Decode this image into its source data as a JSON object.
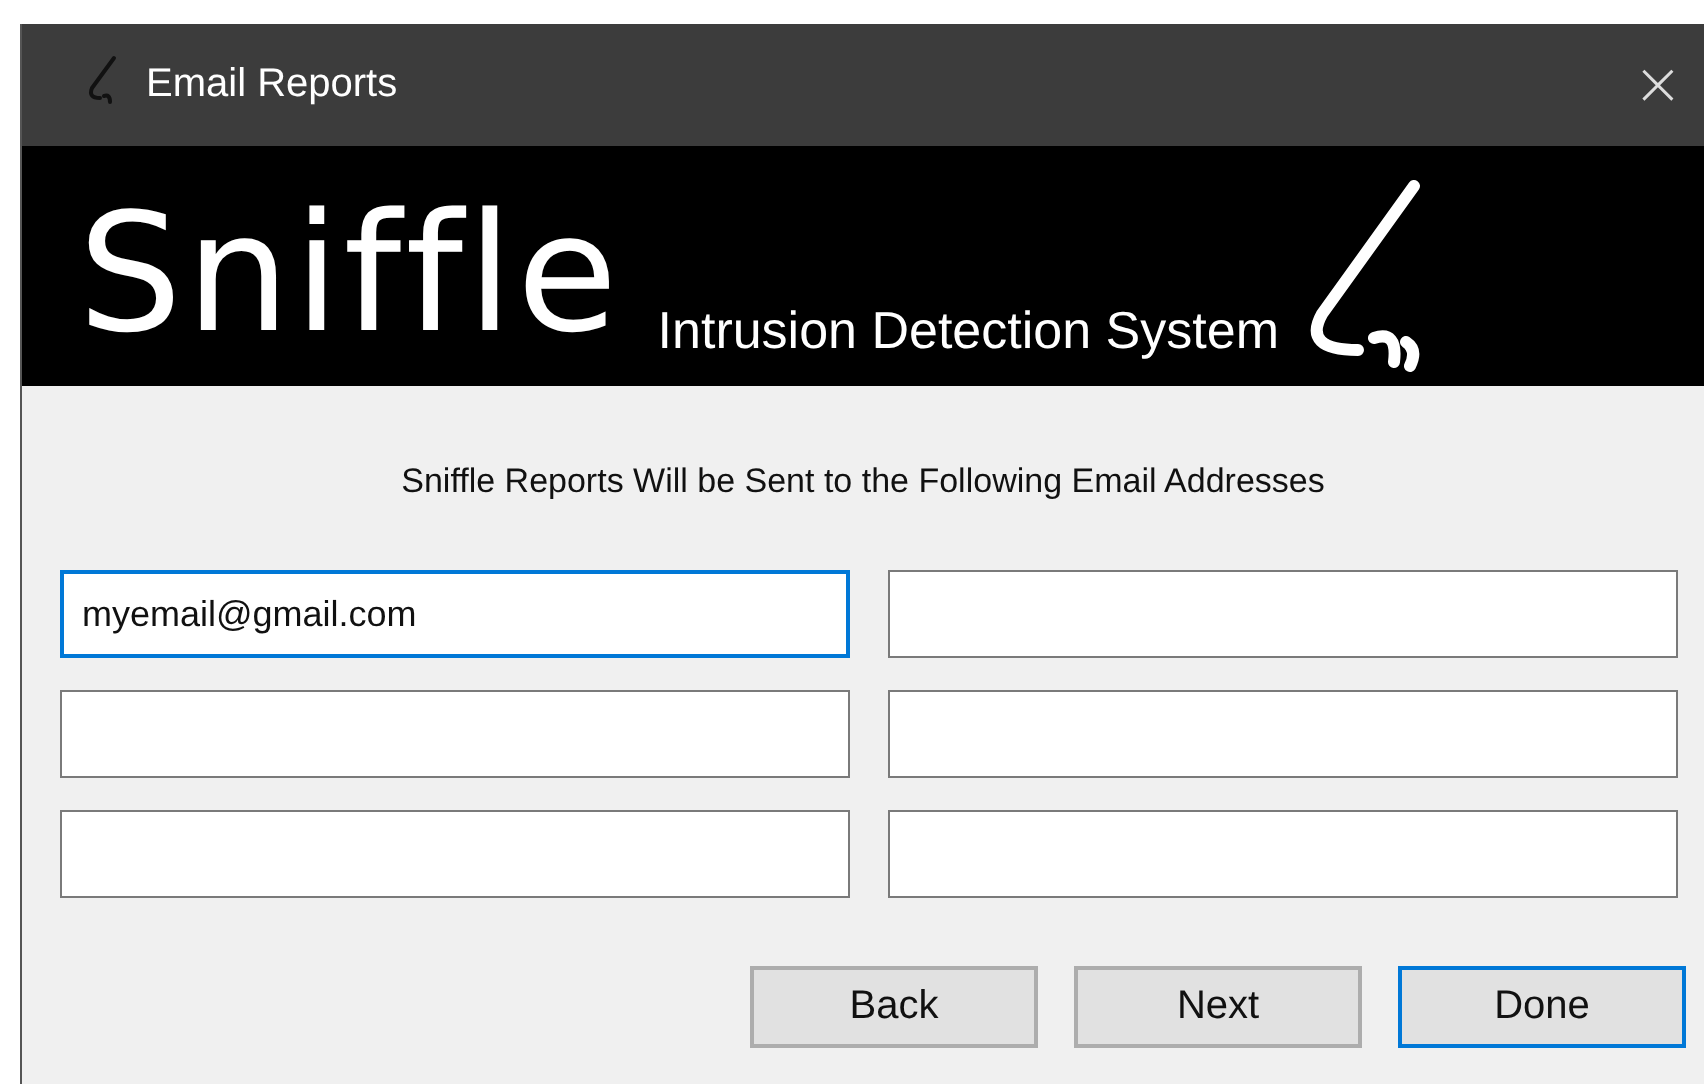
{
  "window": {
    "title": "Email Reports",
    "close": "×"
  },
  "banner": {
    "logo": "Sniffle",
    "tagline": "Intrusion Detection System"
  },
  "instruction": "Sniffle Reports Will be Sent to the Following Email Addresses",
  "fields": [
    {
      "value": "myemail@gmail.com",
      "focused": true
    },
    {
      "focused": false
    },
    {
      "focused": false
    },
    {
      "focused": false
    },
    {
      "focused": false
    },
    {
      "focused": false
    }
  ],
  "buttons": [
    {
      "label": "Back",
      "default": false
    },
    {
      "label": "Next",
      "default": false
    },
    {
      "label": "Done",
      "default": true
    }
  ]
}
